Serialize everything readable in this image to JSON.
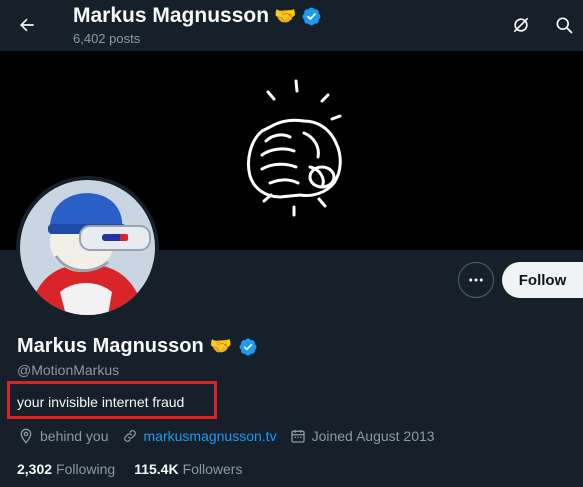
{
  "header": {
    "name": "Markus Magnusson",
    "emoji": "🤝",
    "posts_count": "6,402 posts"
  },
  "profile": {
    "display_name": "Markus Magnusson",
    "emoji": "🤝",
    "handle": "@MotionMarkus",
    "bio": "your invisible internet fraud",
    "location": "behind you",
    "website": "markusmagnusson.tv",
    "joined": "Joined August 2013"
  },
  "stats": {
    "following_count": "2,302",
    "following_label": "Following",
    "followers_count": "115.4K",
    "followers_label": "Followers"
  },
  "actions": {
    "follow_label": "Follow"
  },
  "icons": {
    "back": "arrow-left-icon",
    "grok": "grok-icon",
    "search": "search-icon",
    "more": "more-dots-icon",
    "verified": "verified-badge-icon",
    "location": "location-pin-icon",
    "link": "link-icon",
    "calendar": "calendar-icon"
  },
  "colors": {
    "background": "#15202b",
    "verified": "#1d9bf0",
    "link": "#1d9bf0",
    "muted": "#8b98a5",
    "highlight_box": "#e0212a"
  }
}
